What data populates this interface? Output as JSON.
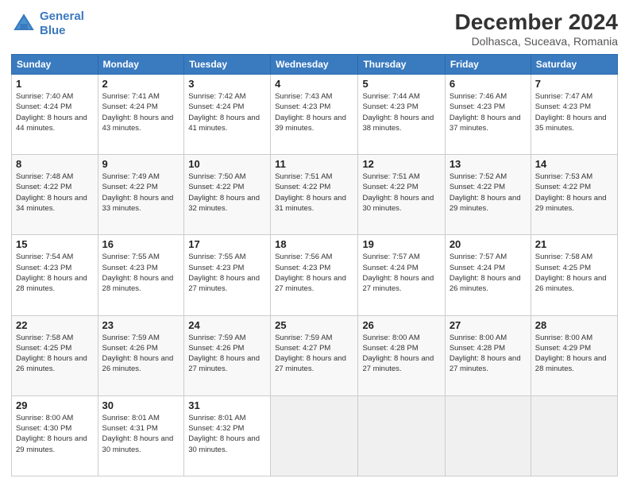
{
  "logo": {
    "line1": "General",
    "line2": "Blue"
  },
  "title": "December 2024",
  "subtitle": "Dolhasca, Suceava, Romania",
  "headers": [
    "Sunday",
    "Monday",
    "Tuesday",
    "Wednesday",
    "Thursday",
    "Friday",
    "Saturday"
  ],
  "weeks": [
    [
      {
        "day": "1",
        "sunrise": "7:40 AM",
        "sunset": "4:24 PM",
        "daylight": "8 hours and 44 minutes."
      },
      {
        "day": "2",
        "sunrise": "7:41 AM",
        "sunset": "4:24 PM",
        "daylight": "8 hours and 43 minutes."
      },
      {
        "day": "3",
        "sunrise": "7:42 AM",
        "sunset": "4:24 PM",
        "daylight": "8 hours and 41 minutes."
      },
      {
        "day": "4",
        "sunrise": "7:43 AM",
        "sunset": "4:23 PM",
        "daylight": "8 hours and 39 minutes."
      },
      {
        "day": "5",
        "sunrise": "7:44 AM",
        "sunset": "4:23 PM",
        "daylight": "8 hours and 38 minutes."
      },
      {
        "day": "6",
        "sunrise": "7:46 AM",
        "sunset": "4:23 PM",
        "daylight": "8 hours and 37 minutes."
      },
      {
        "day": "7",
        "sunrise": "7:47 AM",
        "sunset": "4:23 PM",
        "daylight": "8 hours and 35 minutes."
      }
    ],
    [
      {
        "day": "8",
        "sunrise": "7:48 AM",
        "sunset": "4:22 PM",
        "daylight": "8 hours and 34 minutes."
      },
      {
        "day": "9",
        "sunrise": "7:49 AM",
        "sunset": "4:22 PM",
        "daylight": "8 hours and 33 minutes."
      },
      {
        "day": "10",
        "sunrise": "7:50 AM",
        "sunset": "4:22 PM",
        "daylight": "8 hours and 32 minutes."
      },
      {
        "day": "11",
        "sunrise": "7:51 AM",
        "sunset": "4:22 PM",
        "daylight": "8 hours and 31 minutes."
      },
      {
        "day": "12",
        "sunrise": "7:51 AM",
        "sunset": "4:22 PM",
        "daylight": "8 hours and 30 minutes."
      },
      {
        "day": "13",
        "sunrise": "7:52 AM",
        "sunset": "4:22 PM",
        "daylight": "8 hours and 29 minutes."
      },
      {
        "day": "14",
        "sunrise": "7:53 AM",
        "sunset": "4:22 PM",
        "daylight": "8 hours and 29 minutes."
      }
    ],
    [
      {
        "day": "15",
        "sunrise": "7:54 AM",
        "sunset": "4:23 PM",
        "daylight": "8 hours and 28 minutes."
      },
      {
        "day": "16",
        "sunrise": "7:55 AM",
        "sunset": "4:23 PM",
        "daylight": "8 hours and 28 minutes."
      },
      {
        "day": "17",
        "sunrise": "7:55 AM",
        "sunset": "4:23 PM",
        "daylight": "8 hours and 27 minutes."
      },
      {
        "day": "18",
        "sunrise": "7:56 AM",
        "sunset": "4:23 PM",
        "daylight": "8 hours and 27 minutes."
      },
      {
        "day": "19",
        "sunrise": "7:57 AM",
        "sunset": "4:24 PM",
        "daylight": "8 hours and 27 minutes."
      },
      {
        "day": "20",
        "sunrise": "7:57 AM",
        "sunset": "4:24 PM",
        "daylight": "8 hours and 26 minutes."
      },
      {
        "day": "21",
        "sunrise": "7:58 AM",
        "sunset": "4:25 PM",
        "daylight": "8 hours and 26 minutes."
      }
    ],
    [
      {
        "day": "22",
        "sunrise": "7:58 AM",
        "sunset": "4:25 PM",
        "daylight": "8 hours and 26 minutes."
      },
      {
        "day": "23",
        "sunrise": "7:59 AM",
        "sunset": "4:26 PM",
        "daylight": "8 hours and 26 minutes."
      },
      {
        "day": "24",
        "sunrise": "7:59 AM",
        "sunset": "4:26 PM",
        "daylight": "8 hours and 27 minutes."
      },
      {
        "day": "25",
        "sunrise": "7:59 AM",
        "sunset": "4:27 PM",
        "daylight": "8 hours and 27 minutes."
      },
      {
        "day": "26",
        "sunrise": "8:00 AM",
        "sunset": "4:28 PM",
        "daylight": "8 hours and 27 minutes."
      },
      {
        "day": "27",
        "sunrise": "8:00 AM",
        "sunset": "4:28 PM",
        "daylight": "8 hours and 27 minutes."
      },
      {
        "day": "28",
        "sunrise": "8:00 AM",
        "sunset": "4:29 PM",
        "daylight": "8 hours and 28 minutes."
      }
    ],
    [
      {
        "day": "29",
        "sunrise": "8:00 AM",
        "sunset": "4:30 PM",
        "daylight": "8 hours and 29 minutes."
      },
      {
        "day": "30",
        "sunrise": "8:01 AM",
        "sunset": "4:31 PM",
        "daylight": "8 hours and 30 minutes."
      },
      {
        "day": "31",
        "sunrise": "8:01 AM",
        "sunset": "4:32 PM",
        "daylight": "8 hours and 30 minutes."
      },
      null,
      null,
      null,
      null
    ]
  ]
}
